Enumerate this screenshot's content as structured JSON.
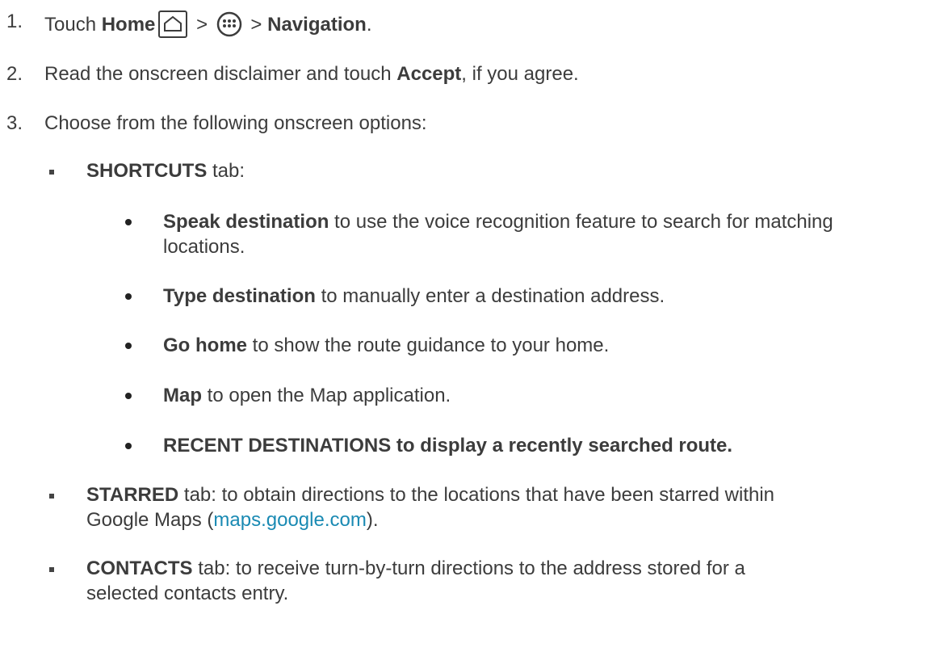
{
  "steps": [
    {
      "number": "1.",
      "prefix": "Touch ",
      "home": "Home",
      "sep1": " > ",
      "sep2": " > ",
      "target": "Navigation",
      "end": "."
    },
    {
      "number": "2.",
      "prefix": "Read the onscreen disclaimer and touch ",
      "bold": "Accept",
      "suffix": ", if you agree."
    },
    {
      "number": "3.",
      "text": "Choose from the following onscreen options:"
    }
  ],
  "shortcuts": {
    "title": "SHORTCUTS",
    "suffix": " tab:",
    "items": [
      {
        "bold": "Speak destination",
        "text": " to use the voice recognition feature to search for matching",
        "cont": "locations."
      },
      {
        "bold": "Type destination",
        "text": " to manually enter a destination address."
      },
      {
        "bold": "Go home",
        "text": " to show the route guidance to your home."
      },
      {
        "bold": "Map",
        "text": " to open the Map application."
      },
      {
        "bold": "RECENT DESTINATIONS to display a recently searched route."
      }
    ]
  },
  "starred": {
    "title": "STARRED",
    "text": " tab: to obtain directions to the locations that have been starred within",
    "cont_prefix": "Google Maps (",
    "link": "maps.google.com",
    "cont_suffix": ")."
  },
  "contacts": {
    "title": "CONTACTS",
    "text": " tab: to receive turn-by-turn directions to the address stored for a",
    "cont": "selected contacts entry."
  },
  "icons": [
    "home-icon",
    "apps-icon"
  ],
  "colors": {
    "text": "#3c3c3c",
    "link": "#1a8ab3"
  }
}
